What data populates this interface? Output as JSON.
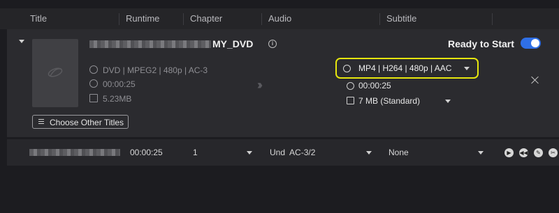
{
  "columns": [
    "Title",
    "Runtime",
    "Chapter",
    "Audio",
    "Subtitle"
  ],
  "main": {
    "title": "MY_DVD",
    "source_format": "DVD | MPEG2 | 480p | AC-3",
    "source_duration": "00:00:25",
    "source_size": "5.23MB",
    "choose_button": "Choose Other Titles",
    "status": "Ready to Start",
    "toggle_on": true,
    "output_format": "MP4 | H264 | 480p | AAC",
    "output_duration": "00:00:25",
    "output_size": "7 MB (Standard)",
    "highlight_color": "#e6e60e",
    "accent_color": "#2f6fe6"
  },
  "row2": {
    "runtime": "00:00:25",
    "chapter": "1",
    "audio_lang": "Und",
    "audio_codec": "AC-3/2",
    "subtitle": "None",
    "controls": [
      "play-icon",
      "rewind-icon",
      "edit-icon",
      "cut-icon"
    ]
  }
}
